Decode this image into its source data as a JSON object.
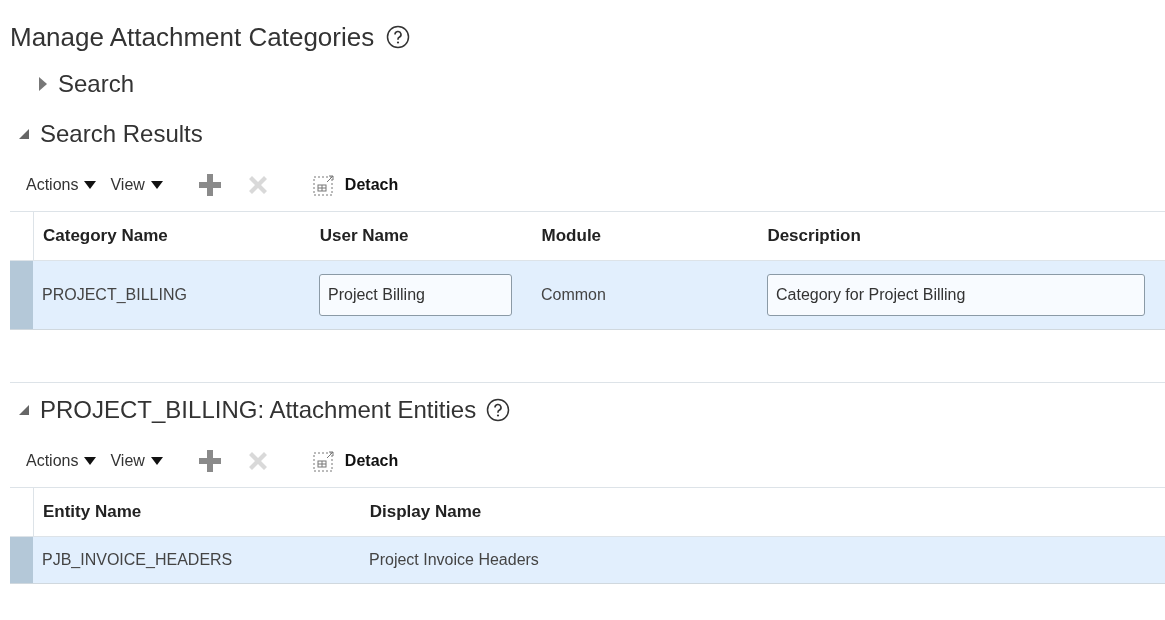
{
  "page": {
    "title": "Manage Attachment Categories"
  },
  "sections": [
    {
      "title": "Search",
      "expanded": false
    },
    {
      "title": "Search Results",
      "expanded": true,
      "toolbar": {
        "menus": [
          "Actions",
          "View"
        ],
        "add_disabled": false,
        "delete_disabled": true,
        "detach": "Detach"
      },
      "table": {
        "columns": [
          "Category Name",
          "User Name",
          "Module",
          "Description"
        ],
        "rows": [
          {
            "selected": true,
            "cells": [
              {
                "kind": "text",
                "text": "PROJECT_BILLING"
              },
              {
                "kind": "input",
                "text": "Project Billing"
              },
              {
                "kind": "text",
                "text": "Common"
              },
              {
                "kind": "input",
                "text": "Category for Project Billing"
              }
            ]
          }
        ]
      }
    },
    {
      "title": "PROJECT_BILLING: Attachment Entities",
      "expanded": true,
      "help": true,
      "toolbar": {
        "menus": [
          "Actions",
          "View"
        ],
        "add_disabled": false,
        "delete_disabled": true,
        "detach": "Detach"
      },
      "table": {
        "columns": [
          "Entity Name",
          "Display Name"
        ],
        "rows": [
          {
            "selected": true,
            "cells": [
              {
                "kind": "text",
                "text": "PJB_INVOICE_HEADERS"
              },
              {
                "kind": "text",
                "text": "Project Invoice Headers"
              }
            ]
          }
        ]
      }
    }
  ]
}
